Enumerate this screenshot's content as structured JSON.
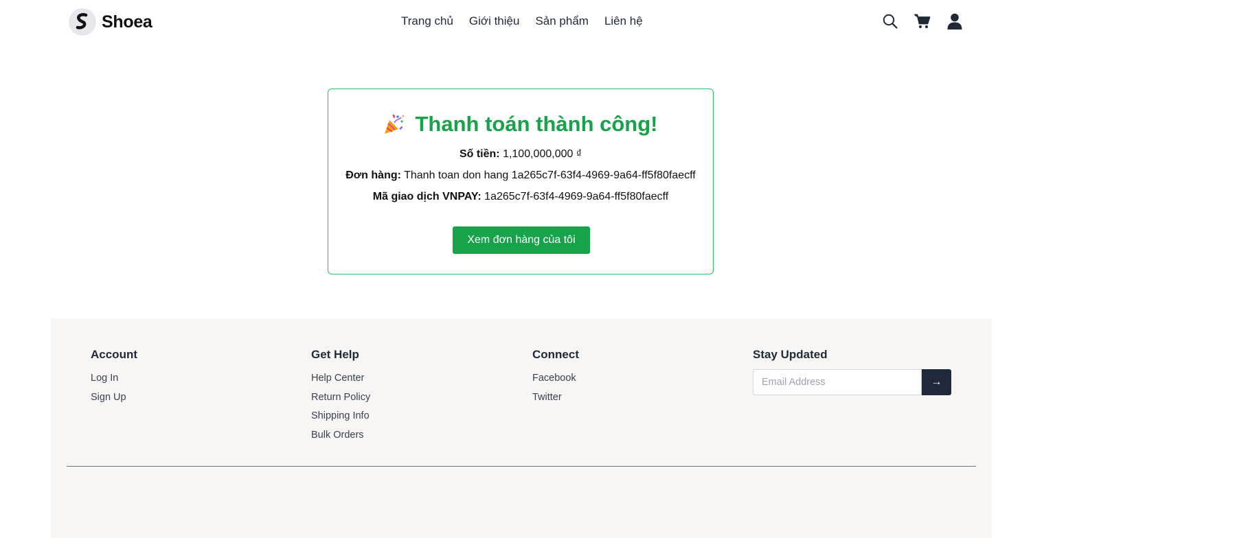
{
  "header": {
    "brand": "Shoea",
    "nav": [
      "Trang chủ",
      "Giới thiệu",
      "Sản phẩm",
      "Liên hệ"
    ],
    "icons": [
      "search-icon",
      "cart-icon",
      "user-icon"
    ]
  },
  "payment": {
    "title": "Thanh toán thành công!",
    "amount_label": "Số tiền:",
    "amount_value": "1,100,000,000 ₫",
    "order_label": "Đơn hàng:",
    "order_value": "Thanh toan don hang 1a265c7f-63f4-4969-9a64-ff5f80faecff",
    "txn_label": "Mã giao dịch VNPAY:",
    "txn_value": "1a265c7f-63f4-4969-9a64-ff5f80faecff",
    "button": "Xem đơn hàng của tôi"
  },
  "footer": {
    "account": {
      "title": "Account",
      "links": [
        "Log In",
        "Sign Up"
      ]
    },
    "help": {
      "title": "Get Help",
      "links": [
        "Help Center",
        "Return Policy",
        "Shipping Info",
        "Bulk Orders"
      ]
    },
    "connect": {
      "title": "Connect",
      "links": [
        "Facebook",
        "Twitter"
      ]
    },
    "newsletter": {
      "title": "Stay Updated",
      "placeholder": "Email Address",
      "submit": "→"
    }
  },
  "colors": {
    "success": "#16a34a",
    "border": "#22c55e",
    "dark": "#1e293b",
    "footer_bg": "#f7f6f5"
  }
}
